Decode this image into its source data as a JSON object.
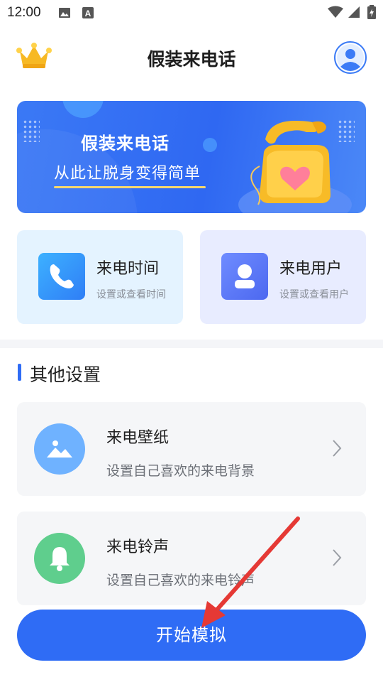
{
  "status_bar": {
    "time": "12:00",
    "icons": [
      "image-icon",
      "a-badge-icon",
      "wifi-icon",
      "signal-icon",
      "battery-icon"
    ]
  },
  "header": {
    "title": "假装来电话",
    "left_icon": "crown-icon",
    "right_icon": "avatar-icon"
  },
  "banner": {
    "title": "假装来电话",
    "subtitle": "从此让脱身变得简单",
    "illustration": "retro-phone-heart-icon"
  },
  "cards": [
    {
      "title": "来电时间",
      "subtitle": "设置或查看时间",
      "icon": "phone-icon"
    },
    {
      "title": "来电用户",
      "subtitle": "设置或查看用户",
      "icon": "user-icon"
    }
  ],
  "section": {
    "title": "其他设置"
  },
  "settings": [
    {
      "title": "来电壁纸",
      "subtitle": "设置自己喜欢的来电背景",
      "icon": "image-mountain-icon"
    },
    {
      "title": "来电铃声",
      "subtitle": "设置自己喜欢的来电铃声",
      "icon": "bell-icon"
    }
  ],
  "start_button": {
    "label": "开始模拟"
  },
  "colors": {
    "primary": "#2f6cf5",
    "card_blue": "#e4f3ff",
    "card_indigo": "#e8ecff",
    "wallpaper_icon": "#6fb2ff",
    "ringtone_icon": "#5fce8d",
    "annotation_arrow": "#e53935"
  }
}
